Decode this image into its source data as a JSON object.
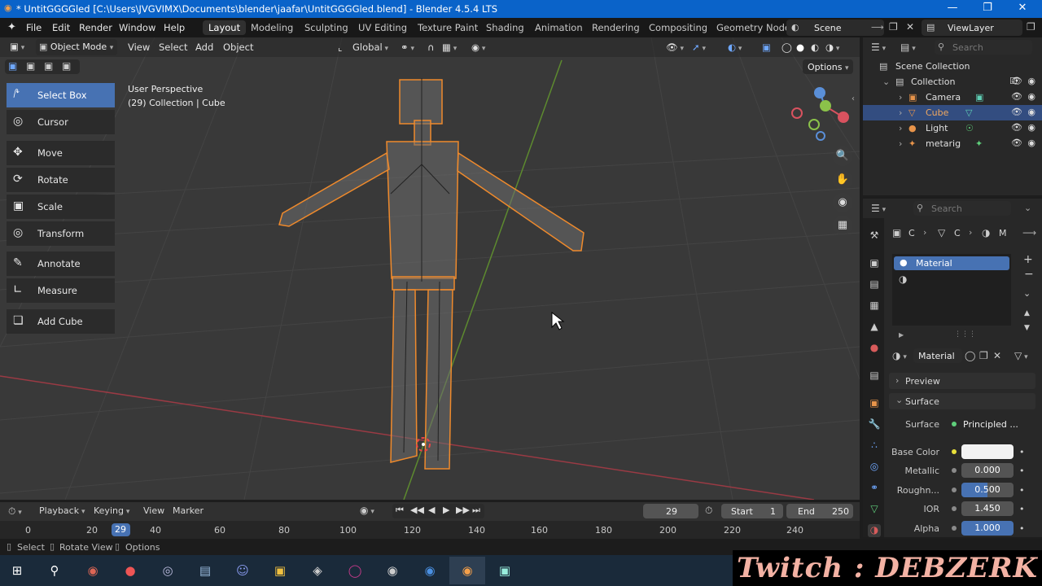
{
  "window": {
    "title": "* UntitGGGGled [C:\\Users\\JVGVIMX\\Documents\\blender\\jaafar\\UntitGGGGled.blend] - Blender 4.5.4 LTS"
  },
  "menu": [
    "File",
    "Edit",
    "Render",
    "Window",
    "Help"
  ],
  "workspaces": [
    "Layout",
    "Modeling",
    "Sculpting",
    "UV Editing",
    "Texture Paint",
    "Shading",
    "Animation",
    "Rendering",
    "Compositing",
    "Geometry Node"
  ],
  "scene_name": "Scene",
  "view_layer": "ViewLayer",
  "viewport_header": {
    "mode": "Object Mode",
    "menus": [
      "View",
      "Select",
      "Add",
      "Object"
    ],
    "transform_orientation": "Global",
    "options": "Options"
  },
  "viewport_info": {
    "line1": "User Perspective",
    "line2": "(29) Collection | Cube"
  },
  "tools": [
    "Select Box",
    "Cursor",
    "Move",
    "Rotate",
    "Scale",
    "Transform",
    "Annotate",
    "Measure",
    "Add Cube"
  ],
  "outliner": {
    "search_placeholder": "Search",
    "root": "Scene Collection",
    "collection": "Collection",
    "objects": [
      "Camera",
      "Cube",
      "Light",
      "metarig"
    ]
  },
  "properties": {
    "search_placeholder": "Search",
    "breadcrumb": [
      "C",
      "C",
      "M"
    ],
    "slot_name": "Material",
    "material_name": "Material",
    "panels": {
      "preview": "Preview",
      "surface": "Surface"
    },
    "surface_shader": "Principled ...",
    "fields": [
      {
        "label": "Base Color",
        "value": ""
      },
      {
        "label": "Metallic",
        "value": "0.000"
      },
      {
        "label": "Roughn...",
        "value": "0.500"
      },
      {
        "label": "IOR",
        "value": "1.450"
      },
      {
        "label": "Alpha",
        "value": "1.000"
      }
    ],
    "surface_label": "Surface"
  },
  "timeline": {
    "menus": [
      "Playback",
      "Keying",
      "View",
      "Marker"
    ],
    "current_frame": "29",
    "start_label": "Start",
    "start": "1",
    "end_label": "End",
    "end": "250",
    "ruler": [
      "0",
      "20",
      "29",
      "40",
      "60",
      "80",
      "100",
      "120",
      "140",
      "160",
      "180",
      "200",
      "220",
      "240"
    ]
  },
  "status_bar": [
    "Select",
    "Rotate View",
    "Options"
  ],
  "watermark": "Twitch : DEBZERK",
  "colors": {
    "accent": "#4772b3",
    "selection_orange": "#ef8a2c",
    "titlebar": "#0a63c9"
  }
}
